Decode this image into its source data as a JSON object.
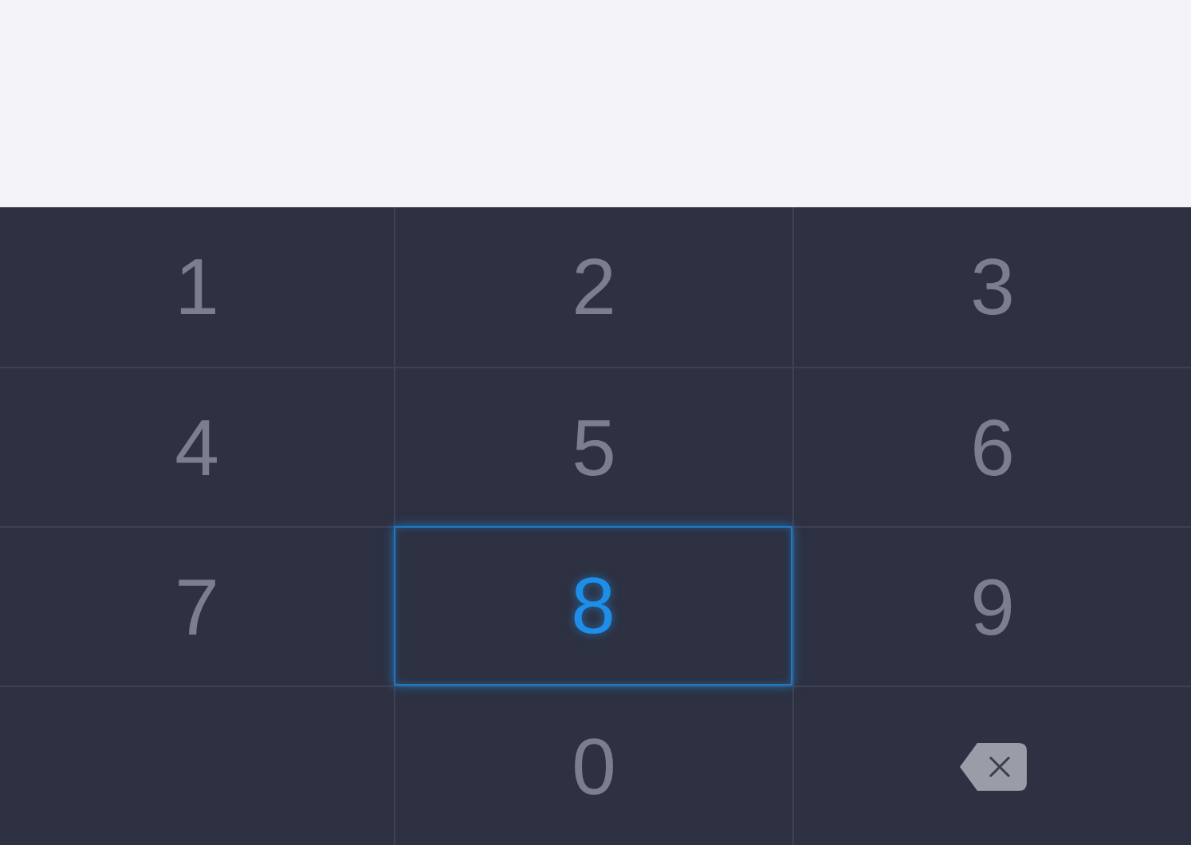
{
  "keypad": {
    "keys": [
      {
        "kind": "digit",
        "label": "1",
        "selected": false
      },
      {
        "kind": "digit",
        "label": "2",
        "selected": false
      },
      {
        "kind": "digit",
        "label": "3",
        "selected": false
      },
      {
        "kind": "digit",
        "label": "4",
        "selected": false
      },
      {
        "kind": "digit",
        "label": "5",
        "selected": false
      },
      {
        "kind": "digit",
        "label": "6",
        "selected": false
      },
      {
        "kind": "digit",
        "label": "7",
        "selected": false
      },
      {
        "kind": "digit",
        "label": "8",
        "selected": true
      },
      {
        "kind": "digit",
        "label": "9",
        "selected": false
      },
      {
        "kind": "blank"
      },
      {
        "kind": "digit",
        "label": "0",
        "selected": false
      },
      {
        "kind": "backspace",
        "selected": false
      }
    ]
  }
}
